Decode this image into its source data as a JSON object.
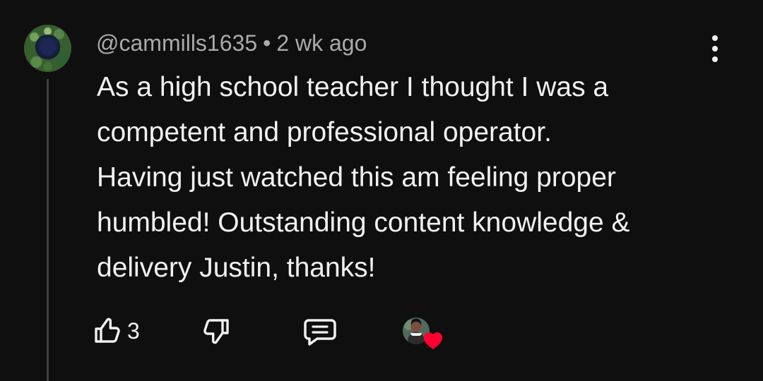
{
  "comment": {
    "author": "@cammills1635",
    "separator": "•",
    "time": "2 wk ago",
    "body_lines": [
      "As a high school teacher I thought I was a",
      "competent and professional operator.",
      "Having just watched this am feeling proper",
      "humbled! Outstanding content knowledge &",
      "delivery Justin, thanks!"
    ]
  },
  "actions": {
    "like_count": "3",
    "icons": {
      "more": "more-vertical-icon",
      "like": "thumbs-up-icon",
      "dislike": "thumbs-down-icon",
      "reply": "reply-comment-icon",
      "heart": "heart-icon"
    }
  },
  "colors": {
    "background": "#0f0f0f",
    "text": "#f1f1f1",
    "metadata": "#aaaaaa",
    "heart": "#ff0033",
    "thread_line": "#3f3f3f"
  }
}
